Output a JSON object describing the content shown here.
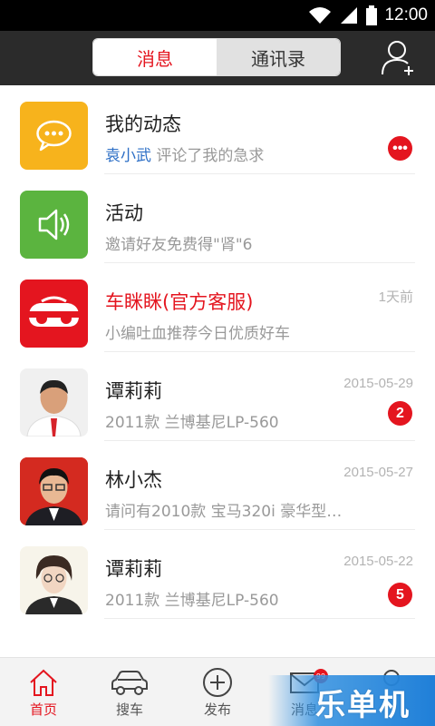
{
  "status_bar": {
    "time": "12:00"
  },
  "header": {
    "tabs": [
      {
        "label": "消息",
        "active": true
      },
      {
        "label": "通讯录",
        "active": false
      }
    ]
  },
  "messages": [
    {
      "title": "我的动态",
      "sub_name": "袁小武",
      "sub_text": " 评论了我的急求",
      "time": "",
      "badge": "•••",
      "icon": "chat-bubble-icon",
      "color": "#f7b31c"
    },
    {
      "title": "活动",
      "sub_name": "",
      "sub_text": "邀请好友免费得\"肾\"6",
      "time": "",
      "badge": "",
      "icon": "speaker-icon",
      "color": "#5bb43f"
    },
    {
      "title": "车眯眯(官方客服)",
      "sub_name": "",
      "sub_text": "小编吐血推荐今日优质好车",
      "time": "1天前",
      "badge": "",
      "icon": "car-logo-icon",
      "color": "#e4151f"
    },
    {
      "title": "谭莉莉",
      "sub_name": "",
      "sub_text": "2011款 兰博基尼LP-560",
      "time": "2015-05-29",
      "badge": "2",
      "icon": "user-photo",
      "color": ""
    },
    {
      "title": "林小杰",
      "sub_name": "",
      "sub_text": "请问有2010款 宝马320i 豪华型…",
      "time": "2015-05-27",
      "badge": "",
      "icon": "user-photo",
      "color": ""
    },
    {
      "title": "谭莉莉",
      "sub_name": "",
      "sub_text": "2011款 兰博基尼LP-560",
      "time": "2015-05-22",
      "badge": "5",
      "icon": "user-photo",
      "color": ""
    }
  ],
  "bottom_nav": [
    {
      "label": "首页",
      "icon": "home-icon",
      "active": true
    },
    {
      "label": "搜车",
      "icon": "car-icon",
      "active": false
    },
    {
      "label": "发布",
      "icon": "plus-circle-icon",
      "active": false
    },
    {
      "label": "消息",
      "icon": "mail-icon",
      "active": false,
      "badge": "99"
    },
    {
      "label": "",
      "icon": "profile-icon",
      "active": false
    }
  ],
  "watermark": {
    "text": "乐单机"
  },
  "colors": {
    "accent": "#e4151f",
    "header_bg": "#2b2b2b",
    "link": "#2d6fc6"
  }
}
